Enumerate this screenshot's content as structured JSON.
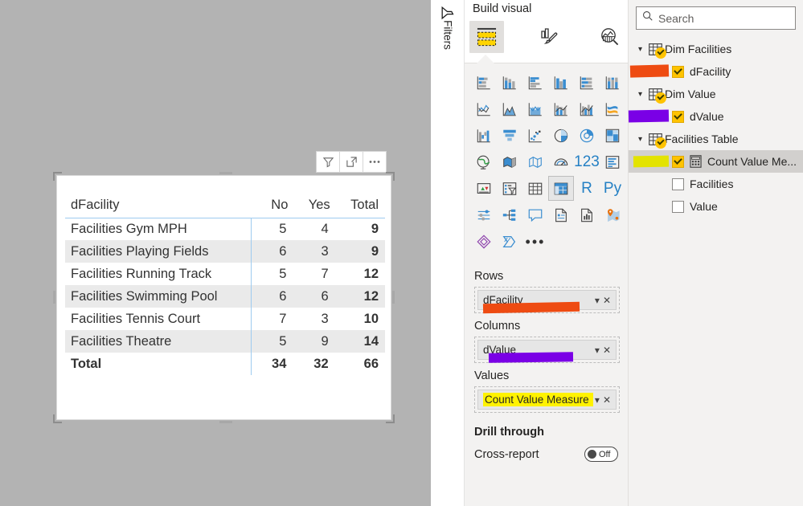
{
  "canvas": {
    "visual_toolbar": [
      {
        "name": "filter-icon",
        "label": "Filters"
      },
      {
        "name": "focus-mode-icon",
        "label": "Focus mode"
      },
      {
        "name": "more-options-icon",
        "label": "More options"
      }
    ]
  },
  "matrix": {
    "row_header": "dFacility",
    "columns": [
      "No",
      "Yes",
      "Total"
    ],
    "rows": [
      {
        "label": "Facilities Gym MPH",
        "no": "5",
        "yes": "4",
        "total": "9"
      },
      {
        "label": "Facilities Playing Fields",
        "no": "6",
        "yes": "3",
        "total": "9"
      },
      {
        "label": "Facilities Running Track",
        "no": "5",
        "yes": "7",
        "total": "12"
      },
      {
        "label": "Facilities Swimming Pool",
        "no": "6",
        "yes": "6",
        "total": "12"
      },
      {
        "label": "Facilities Tennis Court",
        "no": "7",
        "yes": "3",
        "total": "10"
      },
      {
        "label": "Facilities Theatre",
        "no": "5",
        "yes": "9",
        "total": "14"
      }
    ],
    "total_row": {
      "label": "Total",
      "no": "34",
      "yes": "32",
      "total": "66"
    }
  },
  "filters_rail": {
    "label": "Filters"
  },
  "build_pane": {
    "title": "Build visual",
    "tabs": [
      {
        "name": "build-visual-tab",
        "selected": true
      },
      {
        "name": "format-visual-tab",
        "selected": false
      },
      {
        "name": "analytics-tab",
        "selected": false
      }
    ],
    "gallery": [
      {
        "name": "stacked-bar-chart-icon",
        "selected": false
      },
      {
        "name": "stacked-column-chart-icon",
        "selected": false
      },
      {
        "name": "clustered-bar-chart-icon",
        "selected": false
      },
      {
        "name": "clustered-column-chart-icon",
        "selected": false
      },
      {
        "name": "hundred-percent-stacked-bar-chart-icon",
        "selected": false
      },
      {
        "name": "hundred-percent-stacked-column-chart-icon",
        "selected": false
      },
      {
        "name": "line-chart-icon",
        "selected": false
      },
      {
        "name": "area-chart-icon",
        "selected": false
      },
      {
        "name": "stacked-area-chart-icon",
        "selected": false
      },
      {
        "name": "line-and-stacked-column-chart-icon",
        "selected": false
      },
      {
        "name": "line-and-clustered-column-chart-icon",
        "selected": false
      },
      {
        "name": "ribbon-chart-icon",
        "selected": false
      },
      {
        "name": "waterfall-chart-icon",
        "selected": false
      },
      {
        "name": "funnel-chart-icon",
        "selected": false
      },
      {
        "name": "scatter-chart-icon",
        "selected": false
      },
      {
        "name": "pie-chart-icon",
        "selected": false
      },
      {
        "name": "donut-chart-icon",
        "selected": false
      },
      {
        "name": "treemap-icon",
        "selected": false
      },
      {
        "name": "map-icon",
        "selected": false
      },
      {
        "name": "filled-map-icon",
        "selected": false
      },
      {
        "name": "shape-map-icon",
        "selected": false
      },
      {
        "name": "gauge-icon",
        "selected": false
      },
      {
        "name": "card-icon",
        "selected": false,
        "text": "123"
      },
      {
        "name": "multi-row-card-icon",
        "selected": false
      },
      {
        "name": "kpi-icon",
        "selected": false
      },
      {
        "name": "slicer-icon",
        "selected": false
      },
      {
        "name": "table-icon",
        "selected": false
      },
      {
        "name": "matrix-icon",
        "selected": true
      },
      {
        "name": "r-script-visual-icon",
        "selected": false,
        "text": "R"
      },
      {
        "name": "python-visual-icon",
        "selected": false,
        "text": "Py"
      },
      {
        "name": "key-influencers-icon",
        "selected": false
      },
      {
        "name": "decomposition-tree-icon",
        "selected": false
      },
      {
        "name": "qanda-icon",
        "selected": false
      },
      {
        "name": "smart-narrative-icon",
        "selected": false
      },
      {
        "name": "paginated-report-icon",
        "selected": false
      },
      {
        "name": "arcgis-map-icon",
        "selected": false
      },
      {
        "name": "power-apps-icon",
        "selected": false
      },
      {
        "name": "power-automate-icon",
        "selected": false
      },
      {
        "name": "get-more-visuals-icon",
        "selected": false,
        "text": "•••"
      }
    ],
    "wells": [
      {
        "label": "Rows",
        "field": "dFacility",
        "mark": "orange",
        "highlight": false
      },
      {
        "label": "Columns",
        "field": "dValue",
        "mark": "purple",
        "highlight": false
      },
      {
        "label": "Values",
        "field": "Count Value Measure",
        "mark": "none",
        "highlight": true
      }
    ],
    "drill_through": {
      "title": "Drill through",
      "cross_report_label": "Cross-report",
      "toggle_state": "Off"
    }
  },
  "fields_pane": {
    "search_placeholder": "Search",
    "tree": [
      {
        "type": "table",
        "label": "Dim Facilities",
        "expanded": true,
        "checked": true,
        "mark": "none",
        "selected": false
      },
      {
        "type": "field",
        "label": "dFacility",
        "checked": true,
        "mark": "orange",
        "selected": false
      },
      {
        "type": "table",
        "label": "Dim Value",
        "expanded": true,
        "checked": true,
        "mark": "none",
        "selected": false
      },
      {
        "type": "field",
        "label": "dValue",
        "checked": true,
        "mark": "purple",
        "selected": false
      },
      {
        "type": "table",
        "label": "Facilities Table",
        "expanded": true,
        "checked": true,
        "mark": "none",
        "selected": false
      },
      {
        "type": "measure",
        "label": "Count Value Me...",
        "checked": true,
        "mark": "yellow",
        "selected": true
      },
      {
        "type": "field",
        "label": "Facilities",
        "checked": false,
        "mark": "none",
        "selected": false
      },
      {
        "type": "field",
        "label": "Value",
        "checked": false,
        "mark": "none",
        "selected": false
      }
    ]
  },
  "colors": {
    "orange_mark": "#ee4b12",
    "purple_mark": "#7a00e6",
    "yellow_mark": "#e3e300",
    "yellow_highlight": "#fff200",
    "accent_blue": "#9ecbf0",
    "canvas_bg": "#b3b3b3"
  }
}
